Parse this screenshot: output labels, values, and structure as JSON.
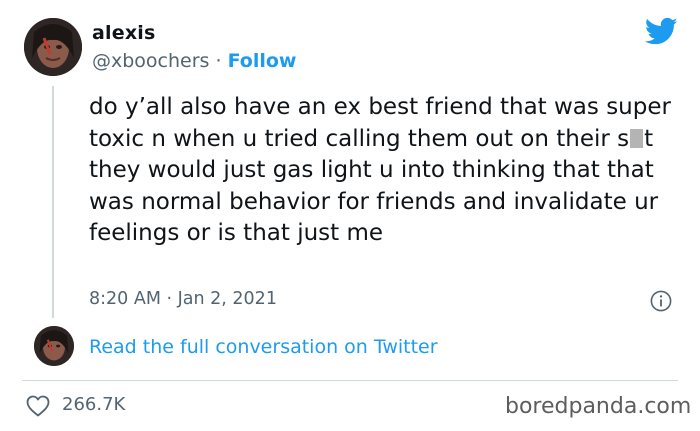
{
  "user": {
    "display_name": "alexis",
    "handle": "@xboochers",
    "separator": " · ",
    "follow_label": "Follow"
  },
  "tweet": {
    "text_before_censor": "do y’all also have an ex best friend that was super toxic n when u tried calling them out on their s",
    "text_after_censor": "t they would just gas light u into thinking that that was normal behavior for friends and invalidate ur feelings or is that just me",
    "timestamp": "8:20 AM · Jan 2, 2021"
  },
  "conversation": {
    "link_label": "Read the full conversation on Twitter"
  },
  "stats": {
    "likes": "266.7K"
  },
  "watermark": "boredpanda.com",
  "icons": {
    "logo": "twitter-bird-icon",
    "info": "info-icon",
    "like": "heart-icon"
  },
  "colors": {
    "accent": "#1d9bf0",
    "secondary_text": "#536471",
    "primary_text": "#0f1419",
    "divider": "#cfd9de"
  }
}
